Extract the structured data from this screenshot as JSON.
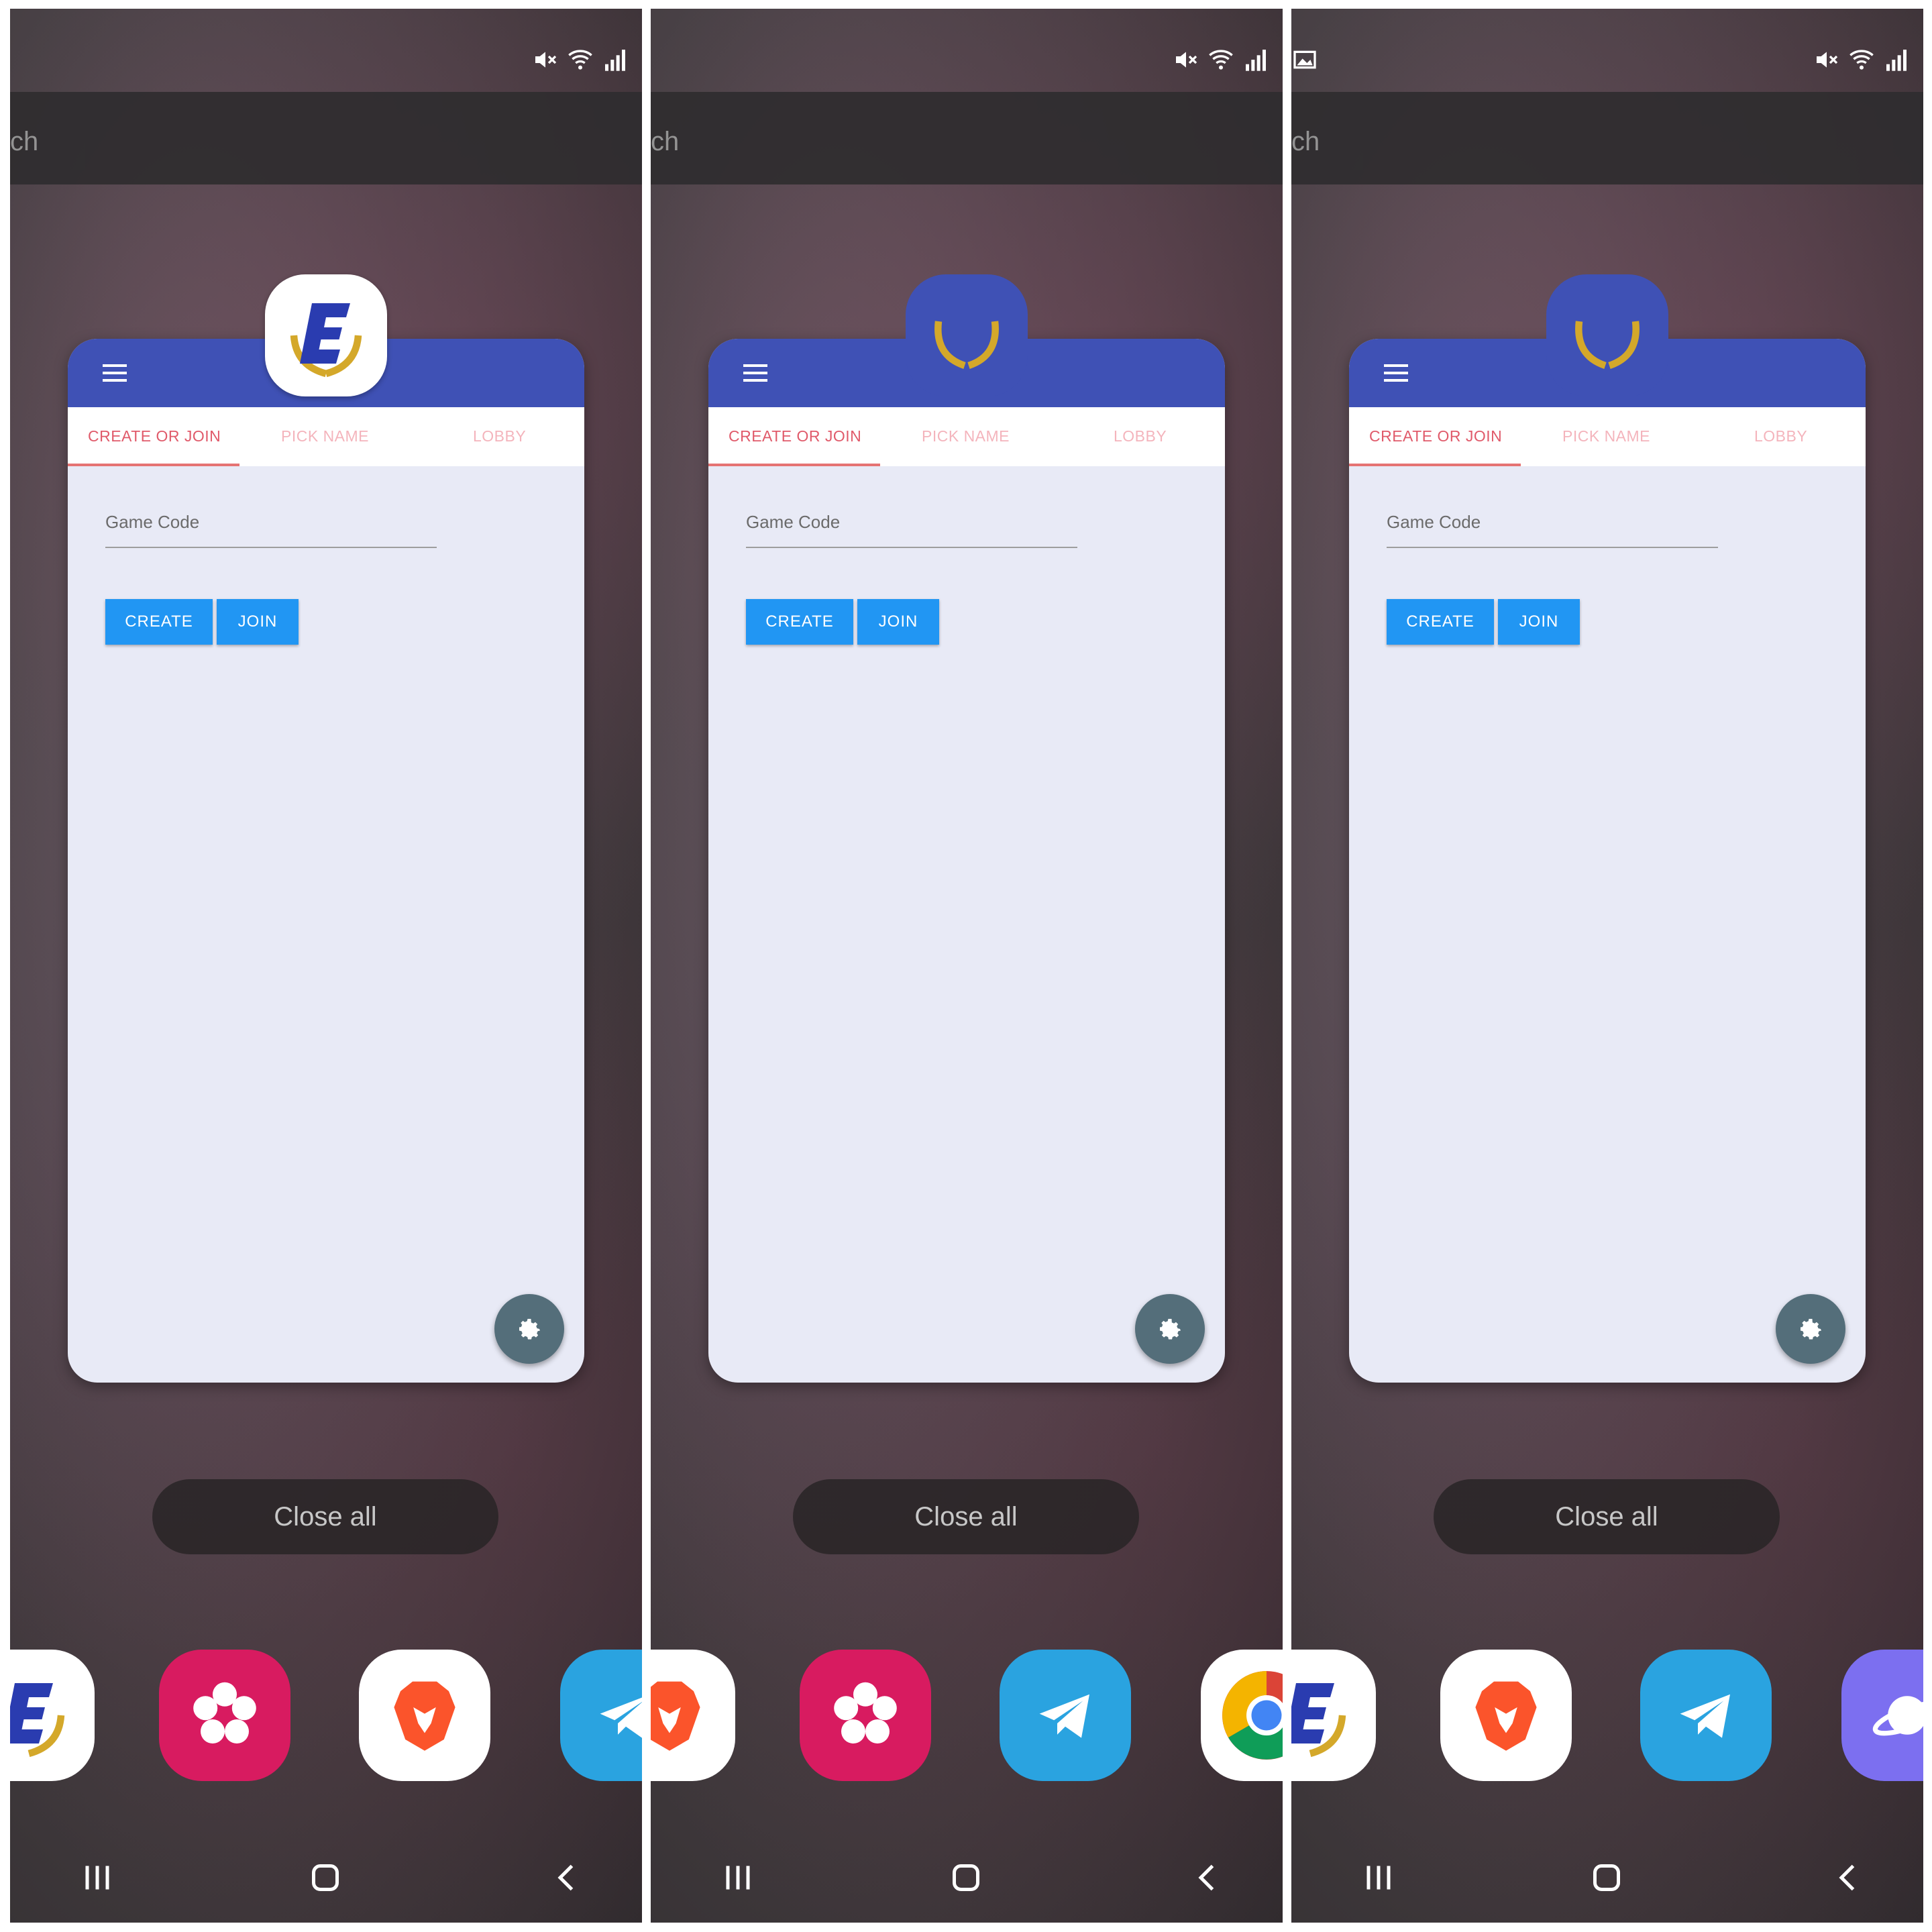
{
  "search_fragment": "ch",
  "app": {
    "tabs": [
      "CREATE OR JOIN",
      "PICK NAME",
      "LOBBY"
    ],
    "game_code_label": "Game Code",
    "create_label": "CREATE",
    "join_label": "JOIN",
    "header_color": "#3f51b5",
    "accent_tab_color": "#e05a6a",
    "button_color": "#2196f3"
  },
  "recents": {
    "close_all_label": "Close all"
  },
  "icons": {
    "status": [
      "mute-icon",
      "wifi-icon",
      "signal-icon"
    ],
    "dock_panel1": [
      "app-e-icon",
      "flower-icon",
      "brave-icon",
      "telegram-icon"
    ],
    "dock_panel2": [
      "brave-icon",
      "flower-icon",
      "telegram-icon",
      "chrome-icon"
    ],
    "dock_panel3": [
      "app-e-icon",
      "brave-icon",
      "telegram-icon",
      "planet-icon"
    ],
    "nav": [
      "recents-icon",
      "home-icon",
      "back-icon"
    ]
  }
}
